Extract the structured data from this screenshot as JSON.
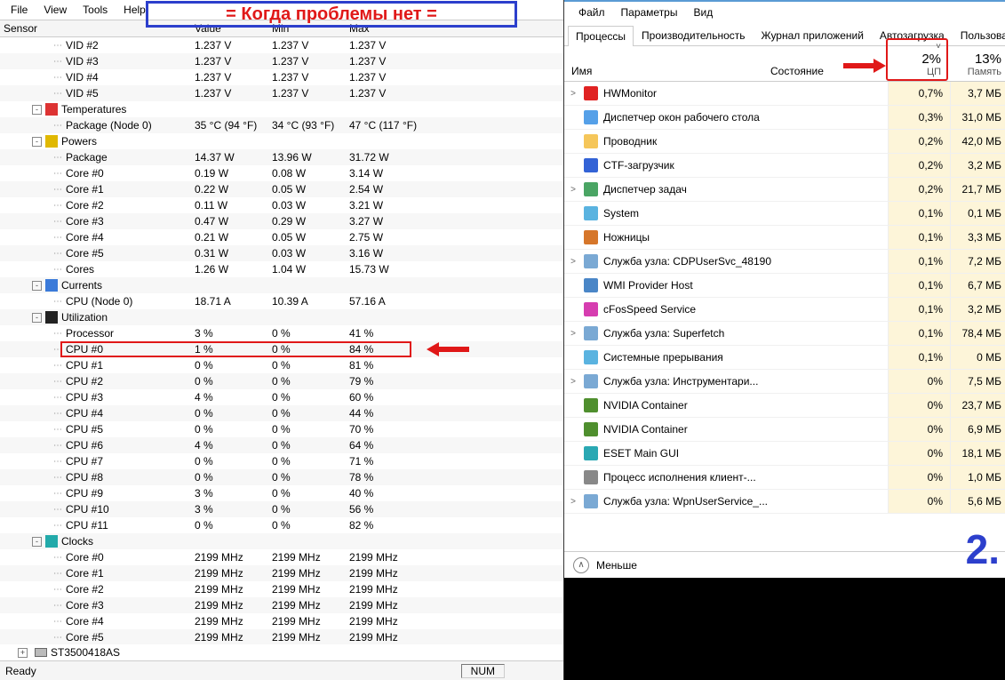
{
  "annotation": {
    "title": "= Когда проблемы нет =",
    "number": "2."
  },
  "left": {
    "menu": [
      "File",
      "View",
      "Tools",
      "Help"
    ],
    "columns": {
      "sensor": "Sensor",
      "value": "Value",
      "min": "Min",
      "max": "Max"
    },
    "groups": [
      {
        "kind": "row",
        "indent": 3,
        "name": "VID #2",
        "v": "1.237 V",
        "mi": "1.237 V",
        "ma": "1.237 V"
      },
      {
        "kind": "row",
        "indent": 3,
        "alt": true,
        "name": "VID #3",
        "v": "1.237 V",
        "mi": "1.237 V",
        "ma": "1.237 V"
      },
      {
        "kind": "row",
        "indent": 3,
        "name": "VID #4",
        "v": "1.237 V",
        "mi": "1.237 V",
        "ma": "1.237 V"
      },
      {
        "kind": "row",
        "indent": 3,
        "alt": true,
        "name": "VID #5",
        "v": "1.237 V",
        "mi": "1.237 V",
        "ma": "1.237 V"
      },
      {
        "kind": "group",
        "indent": 2,
        "exp": "-",
        "icon": "#d33",
        "name": "Temperatures"
      },
      {
        "kind": "row",
        "indent": 3,
        "alt": true,
        "name": "Package (Node 0)",
        "v": "35 °C   (94 °F)",
        "mi": "34 °C   (93 °F)",
        "ma": "47 °C   (117 °F)"
      },
      {
        "kind": "group",
        "indent": 2,
        "exp": "-",
        "icon": "#e0b800",
        "name": "Powers"
      },
      {
        "kind": "row",
        "indent": 3,
        "alt": true,
        "name": "Package",
        "v": "14.37 W",
        "mi": "13.96 W",
        "ma": "31.72 W"
      },
      {
        "kind": "row",
        "indent": 3,
        "name": "Core #0",
        "v": "0.19 W",
        "mi": "0.08 W",
        "ma": "3.14 W"
      },
      {
        "kind": "row",
        "indent": 3,
        "alt": true,
        "name": "Core #1",
        "v": "0.22 W",
        "mi": "0.05 W",
        "ma": "2.54 W"
      },
      {
        "kind": "row",
        "indent": 3,
        "name": "Core #2",
        "v": "0.11 W",
        "mi": "0.03 W",
        "ma": "3.21 W"
      },
      {
        "kind": "row",
        "indent": 3,
        "alt": true,
        "name": "Core #3",
        "v": "0.47 W",
        "mi": "0.29 W",
        "ma": "3.27 W"
      },
      {
        "kind": "row",
        "indent": 3,
        "name": "Core #4",
        "v": "0.21 W",
        "mi": "0.05 W",
        "ma": "2.75 W"
      },
      {
        "kind": "row",
        "indent": 3,
        "alt": true,
        "name": "Core #5",
        "v": "0.31 W",
        "mi": "0.03 W",
        "ma": "3.16 W"
      },
      {
        "kind": "row",
        "indent": 3,
        "name": "Cores",
        "v": "1.26 W",
        "mi": "1.04 W",
        "ma": "15.73 W"
      },
      {
        "kind": "group",
        "indent": 2,
        "alt": true,
        "exp": "-",
        "icon": "#3a7ad9",
        "name": "Currents"
      },
      {
        "kind": "row",
        "indent": 3,
        "name": "CPU (Node 0)",
        "v": "18.71 A",
        "mi": "10.39 A",
        "ma": "57.16 A"
      },
      {
        "kind": "group",
        "indent": 2,
        "alt": true,
        "exp": "-",
        "icon": "#222",
        "name": "Utilization"
      },
      {
        "kind": "row",
        "indent": 3,
        "name": "Processor",
        "v": "3 %",
        "mi": "0 %",
        "ma": "41 %"
      },
      {
        "kind": "row",
        "indent": 3,
        "alt": true,
        "hl": true,
        "name": "CPU #0",
        "v": "1 %",
        "mi": "0 %",
        "ma": "84 %"
      },
      {
        "kind": "row",
        "indent": 3,
        "name": "CPU #1",
        "v": "0 %",
        "mi": "0 %",
        "ma": "81 %"
      },
      {
        "kind": "row",
        "indent": 3,
        "alt": true,
        "name": "CPU #2",
        "v": "0 %",
        "mi": "0 %",
        "ma": "79 %"
      },
      {
        "kind": "row",
        "indent": 3,
        "name": "CPU #3",
        "v": "4 %",
        "mi": "0 %",
        "ma": "60 %"
      },
      {
        "kind": "row",
        "indent": 3,
        "alt": true,
        "name": "CPU #4",
        "v": "0 %",
        "mi": "0 %",
        "ma": "44 %"
      },
      {
        "kind": "row",
        "indent": 3,
        "name": "CPU #5",
        "v": "0 %",
        "mi": "0 %",
        "ma": "70 %"
      },
      {
        "kind": "row",
        "indent": 3,
        "alt": true,
        "name": "CPU #6",
        "v": "4 %",
        "mi": "0 %",
        "ma": "64 %"
      },
      {
        "kind": "row",
        "indent": 3,
        "name": "CPU #7",
        "v": "0 %",
        "mi": "0 %",
        "ma": "71 %"
      },
      {
        "kind": "row",
        "indent": 3,
        "alt": true,
        "name": "CPU #8",
        "v": "0 %",
        "mi": "0 %",
        "ma": "78 %"
      },
      {
        "kind": "row",
        "indent": 3,
        "name": "CPU #9",
        "v": "3 %",
        "mi": "0 %",
        "ma": "40 %"
      },
      {
        "kind": "row",
        "indent": 3,
        "alt": true,
        "name": "CPU #10",
        "v": "3 %",
        "mi": "0 %",
        "ma": "56 %"
      },
      {
        "kind": "row",
        "indent": 3,
        "name": "CPU #11",
        "v": "0 %",
        "mi": "0 %",
        "ma": "82 %"
      },
      {
        "kind": "group",
        "indent": 2,
        "alt": true,
        "exp": "-",
        "icon": "#2aa",
        "name": "Clocks"
      },
      {
        "kind": "row",
        "indent": 3,
        "name": "Core #0",
        "v": "2199 MHz",
        "mi": "2199 MHz",
        "ma": "2199 MHz"
      },
      {
        "kind": "row",
        "indent": 3,
        "alt": true,
        "name": "Core #1",
        "v": "2199 MHz",
        "mi": "2199 MHz",
        "ma": "2199 MHz"
      },
      {
        "kind": "row",
        "indent": 3,
        "name": "Core #2",
        "v": "2199 MHz",
        "mi": "2199 MHz",
        "ma": "2199 MHz"
      },
      {
        "kind": "row",
        "indent": 3,
        "alt": true,
        "name": "Core #3",
        "v": "2199 MHz",
        "mi": "2199 MHz",
        "ma": "2199 MHz"
      },
      {
        "kind": "row",
        "indent": 3,
        "name": "Core #4",
        "v": "2199 MHz",
        "mi": "2199 MHz",
        "ma": "2199 MHz"
      },
      {
        "kind": "row",
        "indent": 3,
        "alt": true,
        "name": "Core #5",
        "v": "2199 MHz",
        "mi": "2199 MHz",
        "ma": "2199 MHz"
      }
    ],
    "drive": "ST3500418AS",
    "status": {
      "ready": "Ready",
      "num": "NUM"
    }
  },
  "right": {
    "menu": [
      "Файл",
      "Параметры",
      "Вид"
    ],
    "tabs": [
      "Процессы",
      "Производительность",
      "Журнал приложений",
      "Автозагрузка",
      "Пользователи"
    ],
    "active_tab": 0,
    "cols": {
      "name": "Имя",
      "state": "Состояние",
      "cpu_pct": "2%",
      "cpu_label": "ЦП",
      "mem_pct": "13%",
      "mem_label": "Память"
    },
    "rows": [
      {
        "chev": ">",
        "icon": "#e02222",
        "name": "HWMonitor",
        "cpu": "0,7%",
        "mem": "3,7 МБ"
      },
      {
        "chev": "",
        "icon": "#55a0e8",
        "name": "Диспетчер окон рабочего стола",
        "cpu": "0,3%",
        "mem": "31,0 МБ"
      },
      {
        "chev": "",
        "icon": "#f5c65a",
        "name": "Проводник",
        "cpu": "0,2%",
        "mem": "42,0 МБ"
      },
      {
        "chev": "",
        "icon": "#3363d6",
        "name": "CTF-загрузчик",
        "cpu": "0,2%",
        "mem": "3,2 МБ"
      },
      {
        "chev": ">",
        "icon": "#4aa564",
        "name": "Диспетчер задач",
        "cpu": "0,2%",
        "mem": "21,7 МБ"
      },
      {
        "chev": "",
        "icon": "#5ab3e0",
        "name": "System",
        "cpu": "0,1%",
        "mem": "0,1 МБ"
      },
      {
        "chev": "",
        "icon": "#d6762a",
        "name": "Ножницы",
        "cpu": "0,1%",
        "mem": "3,3 МБ"
      },
      {
        "chev": ">",
        "icon": "#7aa9d4",
        "name": "Служба узла: CDPUserSvc_48190",
        "cpu": "0,1%",
        "mem": "7,2 МБ"
      },
      {
        "chev": "",
        "icon": "#4a86c7",
        "name": "WMI Provider Host",
        "cpu": "0,1%",
        "mem": "6,7 МБ"
      },
      {
        "chev": "",
        "icon": "#d63db0",
        "name": "cFosSpeed Service",
        "cpu": "0,1%",
        "mem": "3,2 МБ"
      },
      {
        "chev": ">",
        "icon": "#7aa9d4",
        "name": "Служба узла: Superfetch",
        "cpu": "0,1%",
        "mem": "78,4 МБ"
      },
      {
        "chev": "",
        "icon": "#5ab3e0",
        "name": "Системные прерывания",
        "cpu": "0,1%",
        "mem": "0 МБ"
      },
      {
        "chev": ">",
        "icon": "#7aa9d4",
        "name": "Служба узла: Инструментари...",
        "cpu": "0%",
        "mem": "7,5 МБ"
      },
      {
        "chev": "",
        "icon": "#4f8f2e",
        "name": "NVIDIA Container",
        "cpu": "0%",
        "mem": "23,7 МБ"
      },
      {
        "chev": "",
        "icon": "#4f8f2e",
        "name": "NVIDIA Container",
        "cpu": "0%",
        "mem": "6,9 МБ"
      },
      {
        "chev": "",
        "icon": "#2aa8b3",
        "name": "ESET Main GUI",
        "cpu": "0%",
        "mem": "18,1 МБ"
      },
      {
        "chev": "",
        "icon": "#888",
        "name": "Процесс исполнения клиент-...",
        "cpu": "0%",
        "mem": "1,0 МБ"
      },
      {
        "chev": ">",
        "icon": "#7aa9d4",
        "name": "Служба узла: WpnUserService_...",
        "cpu": "0%",
        "mem": "5,6 МБ"
      }
    ],
    "less": "Меньше"
  }
}
